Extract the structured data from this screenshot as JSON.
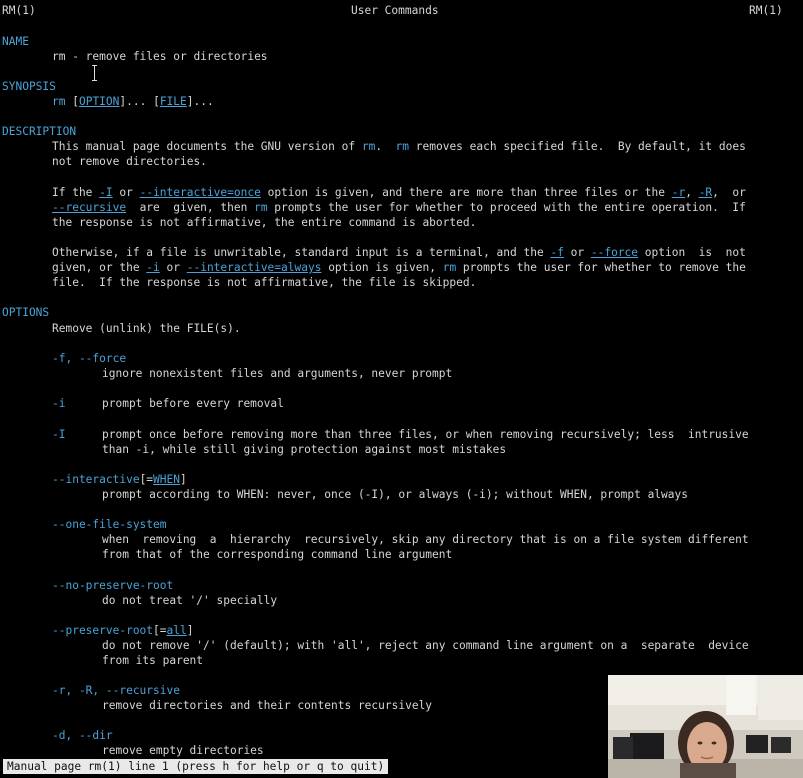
{
  "header": {
    "left": "RM(1)",
    "center": "User Commands",
    "right": "RM(1)"
  },
  "sections": {
    "name": "NAME",
    "synopsis": "SYNOPSIS",
    "description": "DESCRIPTION",
    "options": "OPTIONS"
  },
  "name_line": "rm - remove files or directories",
  "synopsis": {
    "cmd": "rm",
    "opt": "OPTION",
    "file": "FILE",
    "sep1": " [",
    "sep2": "]... [",
    "sep3": "]..."
  },
  "description": {
    "p1_l1_a": "This manual page documents the GNU version of ",
    "p1_l1_cmd1": "rm",
    "p1_l1_b": ".  ",
    "p1_l1_cmd2": "rm",
    "p1_l1_c": " removes each specified file.  By default, it does",
    "p1_l2": "not remove directories.",
    "p2_l1_a": "If the ",
    "p2_l1_o1": "-I",
    "p2_l1_b": " or ",
    "p2_l1_o2": "--interactive=once",
    "p2_l1_c": " option is given, and there are more than three files or the ",
    "p2_l1_o3": "-r",
    "p2_l1_d": ", ",
    "p2_l1_o4": "-R",
    "p2_l1_e": ",  or",
    "p2_l2_o1": "--recursive",
    "p2_l2_a": "  are  given, then ",
    "p2_l2_cmd": "rm",
    "p2_l2_b": " prompts the user for whether to proceed with the entire operation.  If",
    "p2_l3": "the response is not affirmative, the entire command is aborted.",
    "p3_l1_a": "Otherwise, if a file is unwritable, standard input is a terminal, and the ",
    "p3_l1_o1": "-f",
    "p3_l1_b": " or ",
    "p3_l1_o2": "--force",
    "p3_l1_c": " option  is  not",
    "p3_l2_a": "given, or the ",
    "p3_l2_o1": "-i",
    "p3_l2_b": " or ",
    "p3_l2_o2": "--interactive=always",
    "p3_l2_c": " option is given, ",
    "p3_l2_cmd": "rm",
    "p3_l2_d": " prompts the user for whether to remove the",
    "p3_l3": "file.  If the response is not affirmative, the file is skipped."
  },
  "options": {
    "intro": "Remove (unlink) the FILE(s).",
    "force_flag": "-f, --force",
    "force_desc": "ignore nonexistent files and arguments, never prompt",
    "i_flag": "-i",
    "i_desc": "prompt before every removal",
    "I_flag": "-I",
    "I_desc_l1": "prompt once before removing more than three files, or when removing recursively; less  intrusive",
    "I_desc_l2": "than -i, while still giving protection against most mistakes",
    "interactive_flag": "--interactive",
    "interactive_bracket_open": "[=",
    "interactive_arg": "WHEN",
    "interactive_bracket_close": "]",
    "interactive_desc": "prompt according to WHEN: never, once (-I), or always (-i); without WHEN, prompt always",
    "onefs_flag": "--one-file-system",
    "onefs_desc_l1": "when  removing  a  hierarchy  recursively, skip any directory that is on a file system different",
    "onefs_desc_l2": "from that of the corresponding command line argument",
    "nopreserve_flag": "--no-preserve-root",
    "nopreserve_desc": "do not treat '/' specially",
    "preserve_flag": "--preserve-root",
    "preserve_bracket_open": "[=",
    "preserve_arg": "all",
    "preserve_bracket_close": "]",
    "preserve_desc_l1": "do not remove '/' (default); with 'all', reject any command line argument on a  separate  device",
    "preserve_desc_l2": "from its parent",
    "recursive_flag": "-r, -R, --recursive",
    "recursive_desc": "remove directories and their contents recursively",
    "dir_flag": "-d, --dir",
    "dir_desc": "remove empty directories"
  },
  "status_bar": "Manual page rm(1) line 1 (press h for help or q to quit)",
  "colors": {
    "background": "#000000",
    "text": "#d6d6d6",
    "accent": "#4aa3d8",
    "status_bg": "#e9e9e9"
  }
}
